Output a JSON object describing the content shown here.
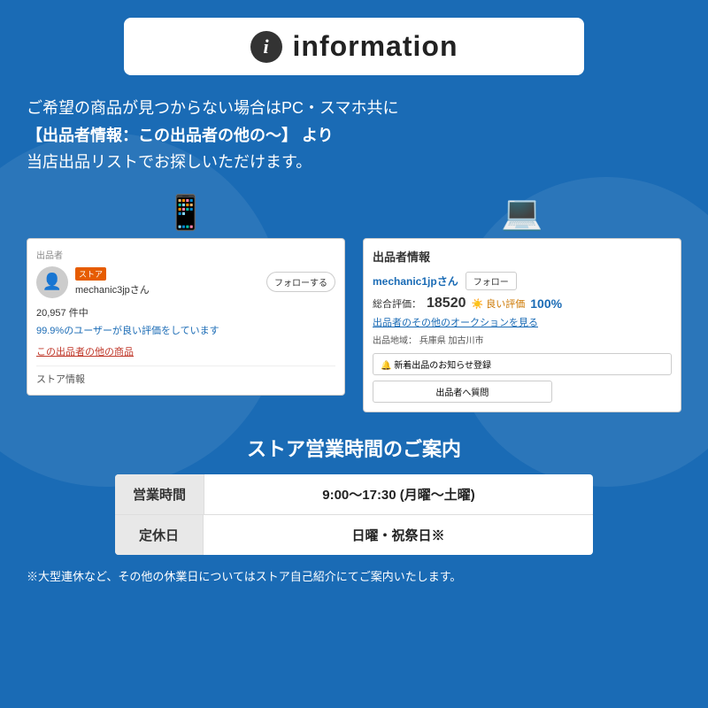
{
  "page": {
    "background_color": "#1a6bb5"
  },
  "header": {
    "icon_label": "i",
    "title": "information"
  },
  "description": {
    "line1": "ご希望の商品が見つからない場合はPC・スマホ共に",
    "line2": "【出品者情報：この出品者の他の〜】 より",
    "line3": "当店出品リストでお探しいただけます。"
  },
  "mobile_screenshot": {
    "device_icon": "📱",
    "seller_label": "出品者",
    "store_badge": "ストア",
    "seller_name": "mechanic3jpさん",
    "follow_btn": "フォローする",
    "stats1": "20,957 件中",
    "stats2": "99.9%のユーザーが良い評価をしています",
    "seller_link": "この出品者の他の商品",
    "store_info": "ストア情報"
  },
  "pc_screenshot": {
    "device_icon": "💻",
    "header_label": "出品者情報",
    "seller_name": "mechanic1jpさん",
    "follow_btn": "フォロー",
    "rating_label": "総合評価：",
    "rating_num": "18520",
    "good_label": "良い評価",
    "good_pct": "100%",
    "auction_link": "出品者のその他のオークションを見る",
    "location_label": "出品地域：",
    "location_value": "兵庫県 加古川市",
    "notify_btn": "🔔 新着出品のお知らせ登録",
    "question_btn": "出品者へ質問"
  },
  "hours_section": {
    "title": "ストア営業時間のご案内",
    "rows": [
      {
        "label": "営業時間",
        "value": "9:00〜17:30 (月曜〜土曜)"
      },
      {
        "label": "定休日",
        "value": "日曜・祝祭日※"
      }
    ],
    "note": "※大型連休など、その他の休業日についてはストア自己紹介にてご案内いたします。"
  }
}
